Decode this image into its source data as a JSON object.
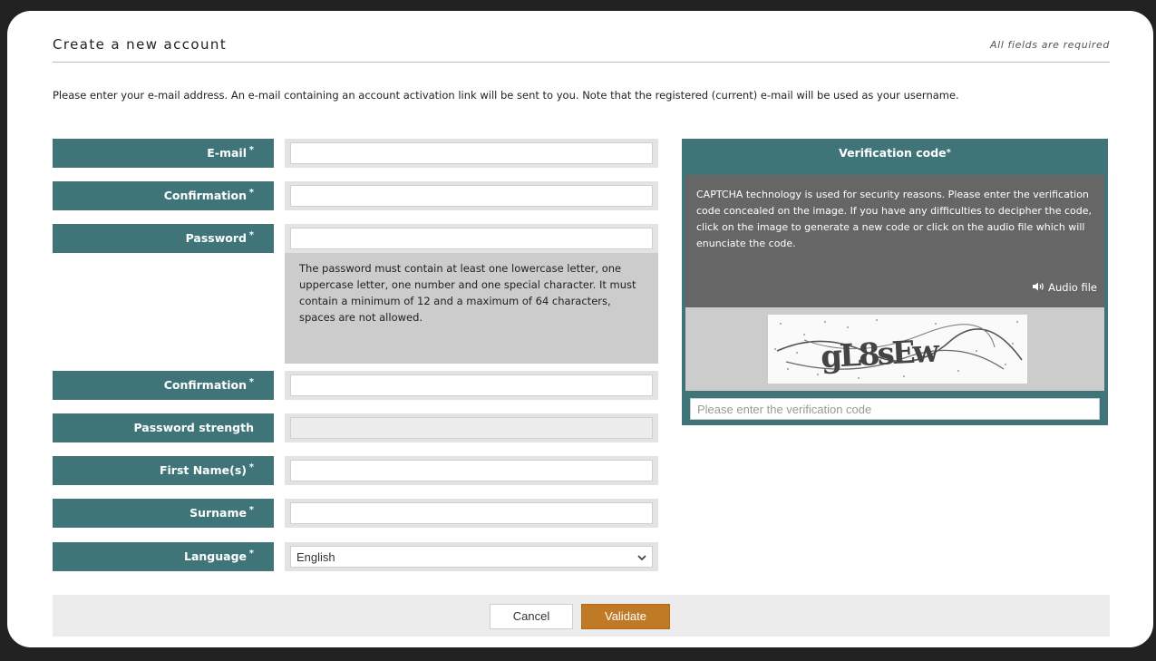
{
  "header": {
    "title": "Create a new account",
    "required_note": "All fields are required"
  },
  "intro": "Please enter your e-mail address. An e-mail containing an account activation link will be sent to you. Note that the registered (current) e-mail will be used as your username.",
  "form": {
    "required_mark": "*",
    "email_label": "E-mail",
    "email_confirmation_label": "Confirmation",
    "password_label": "Password",
    "password_help": "The password must contain at least one lowercase letter, one uppercase letter, one number and one special character. It must contain a minimum of 12 and a maximum of 64 characters, spaces are not allowed.",
    "password_confirmation_label": "Confirmation",
    "password_strength_label": "Password strength",
    "first_name_label": "First Name(s)",
    "surname_label": "Surname",
    "language_label": "Language",
    "language_value": "English"
  },
  "captcha": {
    "title": "Verification code",
    "info": "CAPTCHA technology is used for security reasons. Please enter the verification code concealed on the image. If you have any difficulties to decipher the code, click on the image to generate a new code or click on the audio file which will enunciate the code.",
    "audio_label": "Audio file",
    "image_code": "gL8sEw",
    "input_placeholder": "Please enter the verification code"
  },
  "footer": {
    "cancel_label": "Cancel",
    "validate_label": "Validate"
  },
  "colors": {
    "label_bg": "#3f7579",
    "validate_bg": "#c07a26",
    "captcha_info_bg": "#666666"
  }
}
